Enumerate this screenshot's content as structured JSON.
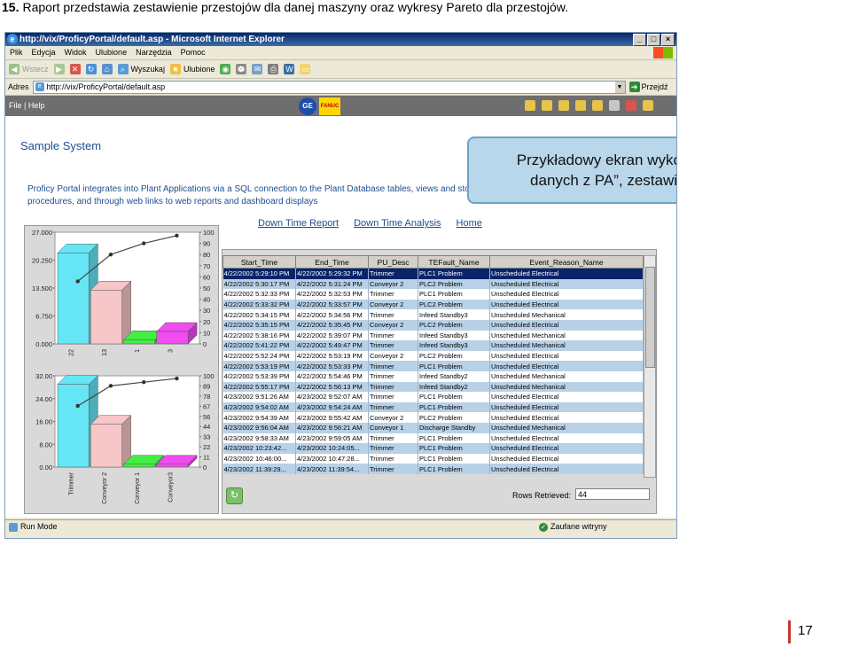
{
  "caption": {
    "number": "15.",
    "text": "Raport przedstawia zestawienie przestojów dla danej maszyny oraz wykresy Pareto dla przestojów."
  },
  "browser": {
    "title": "http://vix/ProficyPortal/default.asp - Microsoft Internet Explorer",
    "menu": [
      "Plik",
      "Edycja",
      "Widok",
      "Ulubione",
      "Narzędzia",
      "Pomoc"
    ],
    "toolbar": {
      "back": "Wstecz",
      "search": "Wyszukaj",
      "favorites": "Ulubione"
    },
    "address_label": "Adres",
    "address": "http://vix/ProficyPortal/default.asp",
    "go": "Przejdź"
  },
  "app": {
    "menu": "File | Help",
    "logos": {
      "ge": "GE",
      "fanuc": "FANUC"
    },
    "sample_title": "Sample System",
    "intro": "Proficy Portal integrates into Plant Applications via a SQL connection to the Plant Database tables, views and stored procedures, and through web links to web reports and dashboard displays",
    "links": [
      "Down Time Report",
      "Down Time Analysis",
      "Home"
    ]
  },
  "callout": {
    "line1": "Przykładowy ekran wykorzystujący „źródła",
    "line2": "danych z PA”, zestawienie przestojów."
  },
  "table": {
    "columns": [
      "Start_Time",
      "End_Time",
      "PU_Desc",
      "TEFault_Name",
      "Event_Reason_Name"
    ],
    "rows": [
      [
        "4/22/2002 5:29:10 PM",
        "4/22/2002 5:29:32 PM",
        "Trimmer",
        "PLC1 Problem",
        "Unscheduled Electrical"
      ],
      [
        "4/22/2002 5:30:17 PM",
        "4/22/2002 5:31:24 PM",
        "Conveyor 2",
        "PLC2 Problem",
        "Unscheduled Electrical"
      ],
      [
        "4/22/2002 5:32:33 PM",
        "4/22/2002 5:32:53 PM",
        "Trimmer",
        "PLC1 Problem",
        "Unscheduled Electrical"
      ],
      [
        "4/22/2002 5:33:32 PM",
        "4/22/2002 5:33:57 PM",
        "Conveyor 2",
        "PLC2 Problem",
        "Unscheduled Electrical"
      ],
      [
        "4/22/2002 5:34:15 PM",
        "4/22/2002 5:34:56 PM",
        "Trimmer",
        "Infeed Standby3",
        "Unscheduled Mechanical"
      ],
      [
        "4/22/2002 5:35:15 PM",
        "4/22/2002 5:35:45 PM",
        "Conveyor 2",
        "PLC2 Problem",
        "Unscheduled Electrical"
      ],
      [
        "4/22/2002 5:38:16 PM",
        "4/22/2002 5:39:07 PM",
        "Trimmer",
        "Infeed Standby3",
        "Unscheduled Mechanical"
      ],
      [
        "4/22/2002 5:41:22 PM",
        "4/22/2002 5:49:47 PM",
        "Trimmer",
        "Infeed Standby3",
        "Unscheduled Mechanical"
      ],
      [
        "4/22/2002 5:52:24 PM",
        "4/22/2002 5:53:19 PM",
        "Conveyor 2",
        "PLC2 Problem",
        "Unscheduled Electrical"
      ],
      [
        "4/22/2002 5:53:19 PM",
        "4/22/2002 5:53:33 PM",
        "Trimmer",
        "PLC1 Problem",
        "Unscheduled Electrical"
      ],
      [
        "4/22/2002 5:53:39 PM",
        "4/22/2002 5:54:46 PM",
        "Trimmer",
        "Infeed Standby2",
        "Unscheduled Mechanical"
      ],
      [
        "4/22/2002 5:55:17 PM",
        "4/22/2002 5:56:13 PM",
        "Trimmer",
        "Infeed Standby2",
        "Unscheduled Mechanical"
      ],
      [
        "4/23/2002 9:51:26 AM",
        "4/23/2002 9:52:07 AM",
        "Trimmer",
        "PLC1 Problem",
        "Unscheduled Electrical"
      ],
      [
        "4/23/2002 9:54:02 AM",
        "4/23/2002 9:54:24 AM",
        "Trimmer",
        "PLC1 Problem",
        "Unscheduled Electrical"
      ],
      [
        "4/23/2002 9:54:39 AM",
        "4/23/2002 9:55:42 AM",
        "Conveyor 2",
        "PLC2 Problem",
        "Unscheduled Electrical"
      ],
      [
        "4/23/2002 9:56:04 AM",
        "4/23/2002 9:56:21 AM",
        "Conveyor 1",
        "Discharge Standby",
        "Unscheduled Mechanical"
      ],
      [
        "4/23/2002 9:58:33 AM",
        "4/23/2002 9:59:05 AM",
        "Trimmer",
        "PLC1 Problem",
        "Unscheduled Electrical"
      ],
      [
        "4/23/2002 10:23:42...",
        "4/23/2002 10:24:05...",
        "Trimmer",
        "PLC1 Problem",
        "Unscheduled Electrical"
      ],
      [
        "4/23/2002 10:46:00...",
        "4/23/2002 10:47:28...",
        "Trimmer",
        "PLC1 Problem",
        "Unscheduled Electrical"
      ],
      [
        "4/23/2002 11:39:29...",
        "4/23/2002 11:39:54...",
        "Trimmer",
        "PLC1 Problem",
        "Unscheduled Electrical"
      ]
    ],
    "rows_label": "Rows Retrieved:",
    "rows_value": "44"
  },
  "status": {
    "left": "Run Mode",
    "zone": "Zaufane witryny"
  },
  "page_number": "17",
  "chart_data": [
    {
      "type": "bar",
      "categories": [
        "22",
        "13",
        "1",
        "3"
      ],
      "values": [
        22,
        13,
        1,
        3
      ],
      "pareto": [
        56,
        80,
        90,
        97
      ],
      "bar_colors": [
        "#66e6f5",
        "#f7c6c8",
        "#44ee44",
        "#f04cf0"
      ],
      "y_ticks": [
        "27.000",
        "20.250",
        "13.500",
        "6.750",
        "0.000"
      ],
      "ylim": [
        0,
        27
      ],
      "y2_ticks": [
        "100",
        "90",
        "80",
        "70",
        "60",
        "50",
        "40",
        "30",
        "20",
        "10",
        "0"
      ],
      "y2lim": [
        0,
        100
      ]
    },
    {
      "type": "bar",
      "categories": [
        "Trimmer",
        "Conveyor 2",
        "Conveyor 1",
        "Conveyor3"
      ],
      "values": [
        29,
        15,
        1,
        1
      ],
      "pareto": [
        67,
        89,
        93,
        97
      ],
      "bar_colors": [
        "#66e6f5",
        "#f7c6c8",
        "#44ee44",
        "#f04cf0"
      ],
      "y_ticks": [
        "32.00",
        "24.00",
        "16.00",
        "8.00",
        "0.00"
      ],
      "ylim": [
        0,
        32
      ],
      "y2_ticks": [
        "100",
        "89",
        "78",
        "67",
        "56",
        "44",
        "33",
        "22",
        "11",
        "0"
      ],
      "y2lim": [
        0,
        100
      ]
    }
  ]
}
